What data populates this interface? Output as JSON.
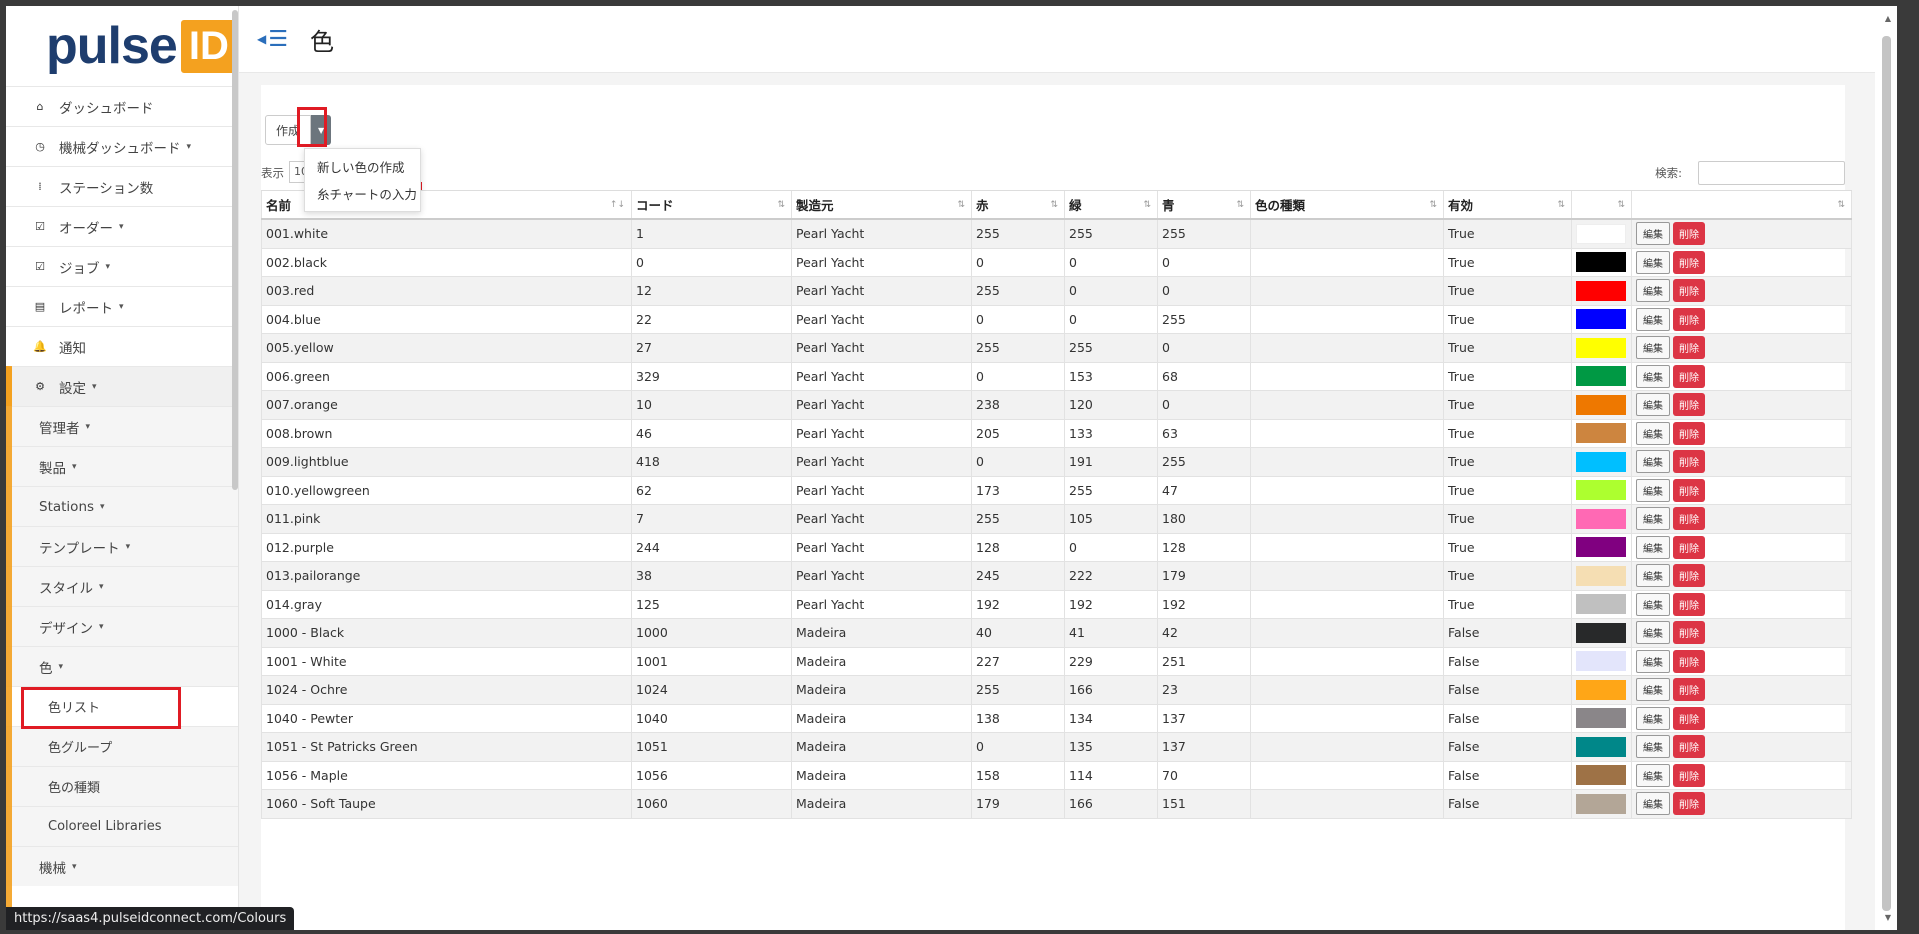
{
  "brand": {
    "logo_text": "pulse",
    "logo_badge": "ID"
  },
  "header": {
    "title": "色"
  },
  "sidebar": {
    "items": [
      {
        "label": "ダッシュボード",
        "icon": "home-icon",
        "caret": false
      },
      {
        "label": "機械ダッシュボード",
        "icon": "gauge-icon",
        "caret": true
      },
      {
        "label": "ステーション数",
        "icon": "stations-icon",
        "caret": false
      },
      {
        "label": "オーダー",
        "icon": "checkbox-icon",
        "caret": true
      },
      {
        "label": "ジョブ",
        "icon": "checkbox-icon",
        "caret": true
      },
      {
        "label": "レポート",
        "icon": "table-icon",
        "caret": true
      },
      {
        "label": "通知",
        "icon": "bell-icon",
        "caret": false
      },
      {
        "label": "設定",
        "icon": "gear-icon",
        "caret": true
      }
    ],
    "settings_sub": [
      "管理者",
      "製品",
      "Stations",
      "テンプレート",
      "スタイル",
      "デザイン",
      "色"
    ],
    "colors_sub": [
      "色リスト",
      "色グループ",
      "色の種類",
      "Coloreel Libraries"
    ],
    "after": [
      "機械"
    ]
  },
  "toolbar": {
    "create_label": "作成",
    "dropdown_items": [
      "新しい色の作成",
      "糸チャートの入力"
    ],
    "show_label": "表示",
    "show_value": "10",
    "search_label": "検索:",
    "search_value": ""
  },
  "table": {
    "columns": [
      "名前",
      "コード",
      "製造元",
      "赤",
      "緑",
      "青",
      "色の種類",
      "有効",
      "",
      ""
    ],
    "edit_label": "編集",
    "delete_label": "削除",
    "rows": [
      [
        "001.white",
        "1",
        "Pearl Yacht",
        "255",
        "255",
        "255",
        "",
        "True",
        "#ffffff"
      ],
      [
        "002.black",
        "0",
        "Pearl Yacht",
        "0",
        "0",
        "0",
        "",
        "True",
        "#000000"
      ],
      [
        "003.red",
        "12",
        "Pearl Yacht",
        "255",
        "0",
        "0",
        "",
        "True",
        "#ff0000"
      ],
      [
        "004.blue",
        "22",
        "Pearl Yacht",
        "0",
        "0",
        "255",
        "",
        "True",
        "#0000ff"
      ],
      [
        "005.yellow",
        "27",
        "Pearl Yacht",
        "255",
        "255",
        "0",
        "",
        "True",
        "#ffff00"
      ],
      [
        "006.green",
        "329",
        "Pearl Yacht",
        "0",
        "153",
        "68",
        "",
        "True",
        "#009944"
      ],
      [
        "007.orange",
        "10",
        "Pearl Yacht",
        "238",
        "120",
        "0",
        "",
        "True",
        "#ee7800"
      ],
      [
        "008.brown",
        "46",
        "Pearl Yacht",
        "205",
        "133",
        "63",
        "",
        "True",
        "#cd853f"
      ],
      [
        "009.lightblue",
        "418",
        "Pearl Yacht",
        "0",
        "191",
        "255",
        "",
        "True",
        "#00bfff"
      ],
      [
        "010.yellowgreen",
        "62",
        "Pearl Yacht",
        "173",
        "255",
        "47",
        "",
        "True",
        "#adff2f"
      ],
      [
        "011.pink",
        "7",
        "Pearl Yacht",
        "255",
        "105",
        "180",
        "",
        "True",
        "#ff69b4"
      ],
      [
        "012.purple",
        "244",
        "Pearl Yacht",
        "128",
        "0",
        "128",
        "",
        "True",
        "#800080"
      ],
      [
        "013.pailorange",
        "38",
        "Pearl Yacht",
        "245",
        "222",
        "179",
        "",
        "True",
        "#f5deb3"
      ],
      [
        "014.gray",
        "125",
        "Pearl Yacht",
        "192",
        "192",
        "192",
        "",
        "True",
        "#c0c0c0"
      ],
      [
        "1000 - Black",
        "1000",
        "Madeira",
        "40",
        "41",
        "42",
        "",
        "False",
        "#28292a"
      ],
      [
        "1001 - White",
        "1001",
        "Madeira",
        "227",
        "229",
        "251",
        "",
        "False",
        "#e3e5fb"
      ],
      [
        "1024 - Ochre",
        "1024",
        "Madeira",
        "255",
        "166",
        "23",
        "",
        "False",
        "#ffa617"
      ],
      [
        "1040 - Pewter",
        "1040",
        "Madeira",
        "138",
        "134",
        "137",
        "",
        "False",
        "#8a8689"
      ],
      [
        "1051 - St Patricks Green",
        "1051",
        "Madeira",
        "0",
        "135",
        "137",
        "",
        "False",
        "#008789"
      ],
      [
        "1056 - Maple",
        "1056",
        "Madeira",
        "158",
        "114",
        "70",
        "",
        "False",
        "#9e7246"
      ],
      [
        "1060 - Soft Taupe",
        "1060",
        "Madeira",
        "179",
        "166",
        "151",
        "",
        "False",
        "#b3a697"
      ]
    ]
  },
  "status_url": "https://saas4.pulseidconnect.com/Colours",
  "colors": {
    "accent": "#f4a11f",
    "brand": "#1e3d6e",
    "danger": "#dc3545",
    "highlight": "#e01b24"
  }
}
